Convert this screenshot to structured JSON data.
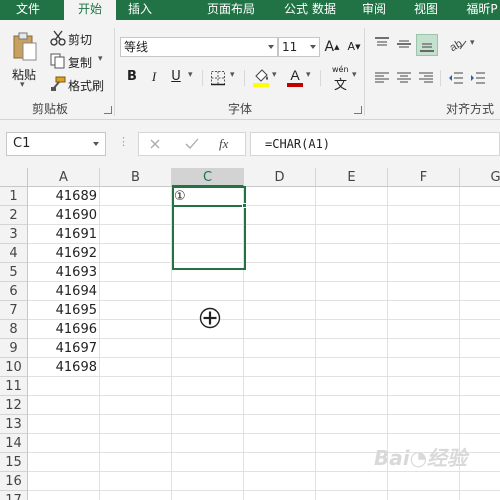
{
  "ribbon_tabs": [
    {
      "label": "文件",
      "active": false
    },
    {
      "label": "开始",
      "active": true
    },
    {
      "label": "插入",
      "active": false
    },
    {
      "label": "页面布局",
      "active": false
    },
    {
      "label": "公式",
      "active": false
    },
    {
      "label": "数据",
      "active": false
    },
    {
      "label": "审阅",
      "active": false
    },
    {
      "label": "视图",
      "active": false
    },
    {
      "label": "福昕P",
      "active": false
    }
  ],
  "clipboard": {
    "paste_label": "粘贴",
    "cut_label": "剪切",
    "copy_label": "复制",
    "format_painter_label": "格式刷",
    "group_label": "剪贴板"
  },
  "font": {
    "font_name": "等线",
    "font_size": "11",
    "bold": "B",
    "italic": "I",
    "underline": "U",
    "grow": "A",
    "shrink": "A",
    "fill_label": "wén",
    "group_label": "字体"
  },
  "alignment": {
    "group_label": "对齐方式"
  },
  "formula_bar": {
    "name_box": "C1",
    "formula": "=CHAR(A1)",
    "fx_label": "fx"
  },
  "sheet": {
    "columns": [
      "A",
      "B",
      "C",
      "D",
      "E",
      "F",
      "G"
    ],
    "rows": [
      "1",
      "2",
      "3",
      "4",
      "5",
      "6",
      "7",
      "8",
      "9",
      "10",
      "11",
      "12",
      "13",
      "14",
      "15",
      "16",
      "17"
    ],
    "column_a_values": [
      "41689",
      "41690",
      "41691",
      "41692",
      "41693",
      "41694",
      "41695",
      "41696",
      "41697",
      "41698"
    ],
    "c1_value": "①",
    "active_cell": "C1",
    "selected_column": "C"
  },
  "colors": {
    "accent": "#217346",
    "ribbon_bg": "#f3f3f3",
    "font_color_bar": "#c00000",
    "highlight_bar": "#ffff00"
  }
}
